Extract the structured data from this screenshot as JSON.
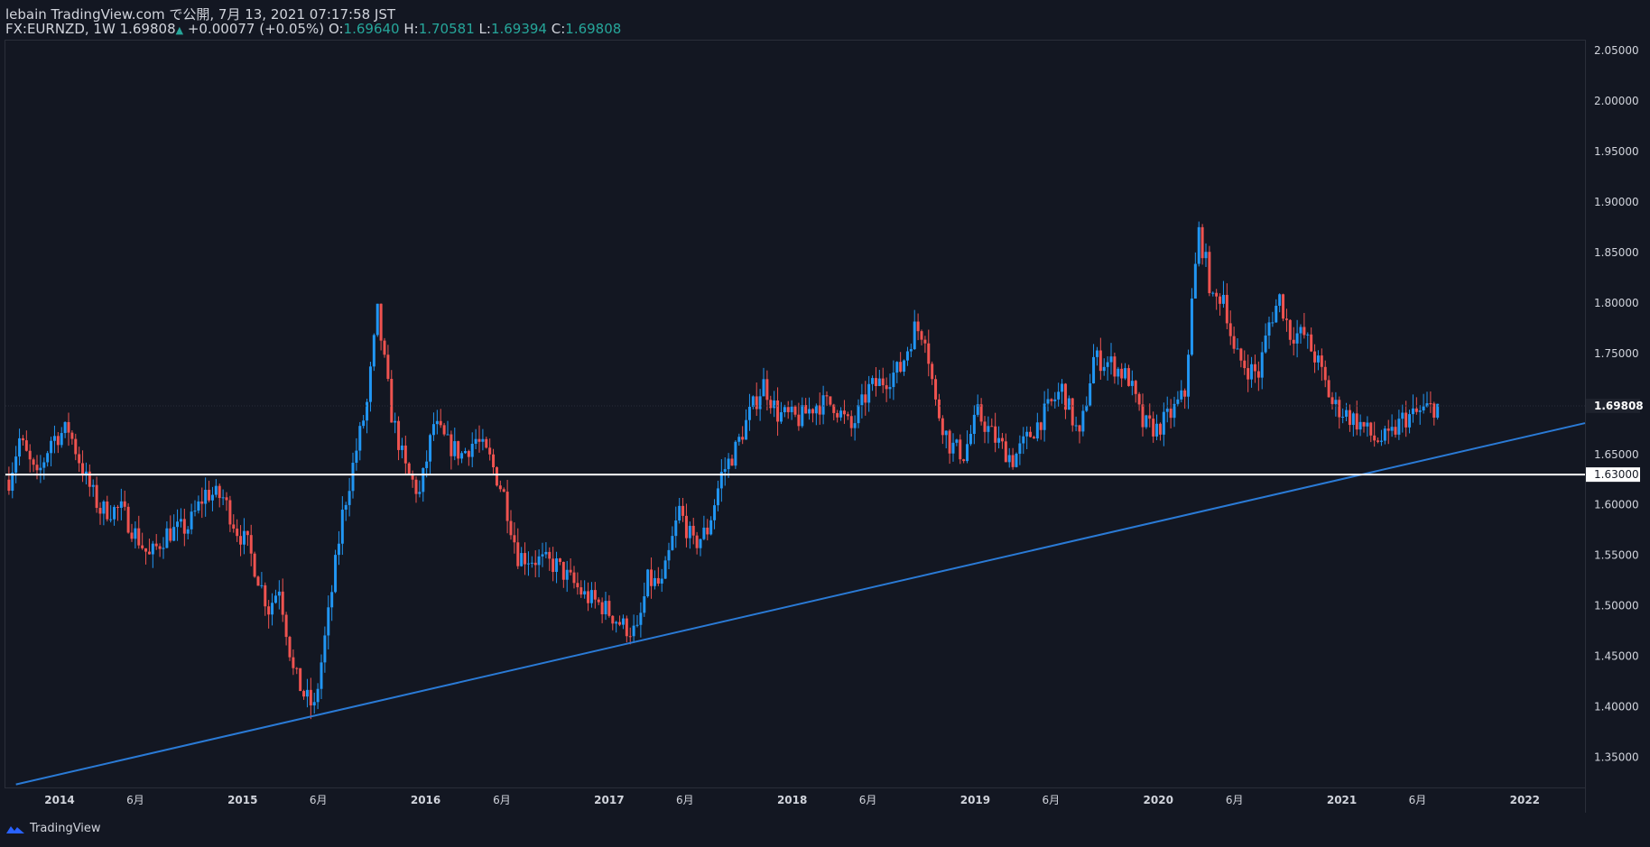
{
  "header": {
    "line1": "lebain TradingView.com で公開, 7月 13, 2021 07:17:58 JST",
    "symbol": "FX:EURNZD, 1W",
    "last": "1.69808",
    "change_arrow": "▲",
    "change": "+0.00077 (+0.05%)",
    "o_label": "O:",
    "o_value": "1.69640",
    "h_label": "H:",
    "h_value": "1.70581",
    "l_label": "L:",
    "l_value": "1.69394",
    "c_label": "C:",
    "c_value": "1.69808"
  },
  "footer": {
    "brand": "TradingView",
    "logo_icon": "tradingview-logo-icon"
  },
  "colors": {
    "background": "#131722",
    "up": "#2196f3",
    "down": "#ef5350",
    "trendline": "#2962ff",
    "hline": "#ffffff",
    "axis_text": "#d1d4dc"
  },
  "chart_data": {
    "type": "candlestick",
    "symbol": "FX:EURNZD",
    "timeframe": "1W",
    "ylim": [
      1.32,
      2.06
    ],
    "y_ticks": [
      {
        "value": 2.05,
        "label": "2.05000"
      },
      {
        "value": 2.0,
        "label": "2.00000"
      },
      {
        "value": 1.95,
        "label": "1.95000"
      },
      {
        "value": 1.9,
        "label": "1.90000"
      },
      {
        "value": 1.85,
        "label": "1.85000"
      },
      {
        "value": 1.8,
        "label": "1.80000"
      },
      {
        "value": 1.75,
        "label": "1.75000"
      },
      {
        "value": 1.65,
        "label": "1.65000"
      },
      {
        "value": 1.6,
        "label": "1.60000"
      },
      {
        "value": 1.55,
        "label": "1.55000"
      },
      {
        "value": 1.5,
        "label": "1.50000"
      },
      {
        "value": 1.45,
        "label": "1.45000"
      },
      {
        "value": 1.4,
        "label": "1.40000"
      },
      {
        "value": 1.35,
        "label": "1.35000"
      }
    ],
    "x_ticks": [
      {
        "date": "2014-01-01",
        "label": "2014"
      },
      {
        "date": "2014-06-01",
        "label": "6月"
      },
      {
        "date": "2015-01-01",
        "label": "2015"
      },
      {
        "date": "2015-06-01",
        "label": "6月"
      },
      {
        "date": "2016-01-01",
        "label": "2016"
      },
      {
        "date": "2016-06-01",
        "label": "6月"
      },
      {
        "date": "2017-01-01",
        "label": "2017"
      },
      {
        "date": "2017-06-01",
        "label": "6月"
      },
      {
        "date": "2018-01-01",
        "label": "2018"
      },
      {
        "date": "2018-06-01",
        "label": "6月"
      },
      {
        "date": "2019-01-01",
        "label": "2019"
      },
      {
        "date": "2019-06-01",
        "label": "6月"
      },
      {
        "date": "2020-01-01",
        "label": "2020"
      },
      {
        "date": "2020-06-01",
        "label": "6月"
      },
      {
        "date": "2021-01-01",
        "label": "2021"
      },
      {
        "date": "2021-06-01",
        "label": "6月"
      },
      {
        "date": "2022-01-01",
        "label": "2022"
      }
    ],
    "x_range": [
      "2013-09-15",
      "2022-05-01"
    ],
    "last_price": {
      "value": 1.69808,
      "label": "1.69808"
    },
    "horizontal_line": {
      "value": 1.63,
      "label": "1.63000"
    },
    "trendline": {
      "points": [
        {
          "date": "2013-10-06",
          "value": 1.323
        },
        {
          "date": "2022-05-01",
          "value": 1.681
        }
      ]
    },
    "anchors": [
      {
        "date": "2013-09-22",
        "value": 1.625
      },
      {
        "date": "2013-10-13",
        "value": 1.665
      },
      {
        "date": "2013-11-17",
        "value": 1.625
      },
      {
        "date": "2013-12-15",
        "value": 1.665
      },
      {
        "date": "2014-01-19",
        "value": 1.675
      },
      {
        "date": "2014-02-23",
        "value": 1.625
      },
      {
        "date": "2014-03-23",
        "value": 1.595
      },
      {
        "date": "2014-05-04",
        "value": 1.595
      },
      {
        "date": "2014-06-29",
        "value": 1.548
      },
      {
        "date": "2014-08-03",
        "value": 1.572
      },
      {
        "date": "2014-09-14",
        "value": 1.578
      },
      {
        "date": "2014-10-19",
        "value": 1.612
      },
      {
        "date": "2014-11-23",
        "value": 1.607
      },
      {
        "date": "2014-12-21",
        "value": 1.575
      },
      {
        "date": "2015-01-11",
        "value": 1.56
      },
      {
        "date": "2015-02-22",
        "value": 1.497
      },
      {
        "date": "2015-03-15",
        "value": 1.52
      },
      {
        "date": "2015-04-12",
        "value": 1.435
      },
      {
        "date": "2015-05-03",
        "value": 1.412
      },
      {
        "date": "2015-05-24",
        "value": 1.398
      },
      {
        "date": "2015-06-21",
        "value": 1.49
      },
      {
        "date": "2015-07-19",
        "value": 1.59
      },
      {
        "date": "2015-08-16",
        "value": 1.655
      },
      {
        "date": "2015-09-06",
        "value": 1.7
      },
      {
        "date": "2015-09-27",
        "value": 1.79
      },
      {
        "date": "2015-10-25",
        "value": 1.69
      },
      {
        "date": "2015-11-22",
        "value": 1.635
      },
      {
        "date": "2015-12-20",
        "value": 1.61
      },
      {
        "date": "2016-01-17",
        "value": 1.68
      },
      {
        "date": "2016-02-14",
        "value": 1.66
      },
      {
        "date": "2016-03-13",
        "value": 1.65
      },
      {
        "date": "2016-04-10",
        "value": 1.665
      },
      {
        "date": "2016-05-08",
        "value": 1.645
      },
      {
        "date": "2016-06-05",
        "value": 1.61
      },
      {
        "date": "2016-07-03",
        "value": 1.55
      },
      {
        "date": "2016-08-14",
        "value": 1.545
      },
      {
        "date": "2016-09-18",
        "value": 1.54
      },
      {
        "date": "2016-10-16",
        "value": 1.525
      },
      {
        "date": "2016-11-13",
        "value": 1.51
      },
      {
        "date": "2016-12-18",
        "value": 1.5
      },
      {
        "date": "2017-01-29",
        "value": 1.48
      },
      {
        "date": "2017-02-26",
        "value": 1.473
      },
      {
        "date": "2017-03-19",
        "value": 1.525
      },
      {
        "date": "2017-04-16",
        "value": 1.52
      },
      {
        "date": "2017-05-21",
        "value": 1.595
      },
      {
        "date": "2017-06-18",
        "value": 1.56
      },
      {
        "date": "2017-07-16",
        "value": 1.575
      },
      {
        "date": "2017-08-13",
        "value": 1.63
      },
      {
        "date": "2017-09-10",
        "value": 1.655
      },
      {
        "date": "2017-10-08",
        "value": 1.69
      },
      {
        "date": "2017-11-05",
        "value": 1.72
      },
      {
        "date": "2017-12-03",
        "value": 1.69
      },
      {
        "date": "2018-01-14",
        "value": 1.685
      },
      {
        "date": "2018-02-18",
        "value": 1.7
      },
      {
        "date": "2018-03-25",
        "value": 1.7
      },
      {
        "date": "2018-04-29",
        "value": 1.675
      },
      {
        "date": "2018-06-03",
        "value": 1.715
      },
      {
        "date": "2018-07-08",
        "value": 1.725
      },
      {
        "date": "2018-08-05",
        "value": 1.735
      },
      {
        "date": "2018-09-02",
        "value": 1.775
      },
      {
        "date": "2018-09-23",
        "value": 1.77
      },
      {
        "date": "2018-10-14",
        "value": 1.7
      },
      {
        "date": "2018-11-11",
        "value": 1.66
      },
      {
        "date": "2018-12-09",
        "value": 1.65
      },
      {
        "date": "2019-01-06",
        "value": 1.69
      },
      {
        "date": "2019-02-10",
        "value": 1.665
      },
      {
        "date": "2019-03-17",
        "value": 1.645
      },
      {
        "date": "2019-04-14",
        "value": 1.665
      },
      {
        "date": "2019-05-19",
        "value": 1.69
      },
      {
        "date": "2019-06-23",
        "value": 1.715
      },
      {
        "date": "2019-07-28",
        "value": 1.665
      },
      {
        "date": "2019-08-25",
        "value": 1.745
      },
      {
        "date": "2019-09-29",
        "value": 1.74
      },
      {
        "date": "2019-11-03",
        "value": 1.725
      },
      {
        "date": "2019-12-01",
        "value": 1.68
      },
      {
        "date": "2019-12-29",
        "value": 1.675
      },
      {
        "date": "2020-01-26",
        "value": 1.69
      },
      {
        "date": "2020-02-23",
        "value": 1.71
      },
      {
        "date": "2020-03-08",
        "value": 1.8
      },
      {
        "date": "2020-03-22",
        "value": 1.87
      },
      {
        "date": "2020-04-05",
        "value": 1.84
      },
      {
        "date": "2020-04-19",
        "value": 1.8
      },
      {
        "date": "2020-05-10",
        "value": 1.81
      },
      {
        "date": "2020-05-31",
        "value": 1.75
      },
      {
        "date": "2020-06-28",
        "value": 1.735
      },
      {
        "date": "2020-07-19",
        "value": 1.73
      },
      {
        "date": "2020-08-09",
        "value": 1.78
      },
      {
        "date": "2020-08-30",
        "value": 1.805
      },
      {
        "date": "2020-09-20",
        "value": 1.77
      },
      {
        "date": "2020-10-18",
        "value": 1.768
      },
      {
        "date": "2020-11-15",
        "value": 1.74
      },
      {
        "date": "2020-12-13",
        "value": 1.7
      },
      {
        "date": "2021-01-10",
        "value": 1.69
      },
      {
        "date": "2021-02-07",
        "value": 1.68
      },
      {
        "date": "2021-03-07",
        "value": 1.665
      },
      {
        "date": "2021-04-04",
        "value": 1.665
      },
      {
        "date": "2021-05-02",
        "value": 1.685
      },
      {
        "date": "2021-05-30",
        "value": 1.69
      },
      {
        "date": "2021-06-20",
        "value": 1.695
      },
      {
        "date": "2021-07-11",
        "value": 1.698
      }
    ]
  }
}
